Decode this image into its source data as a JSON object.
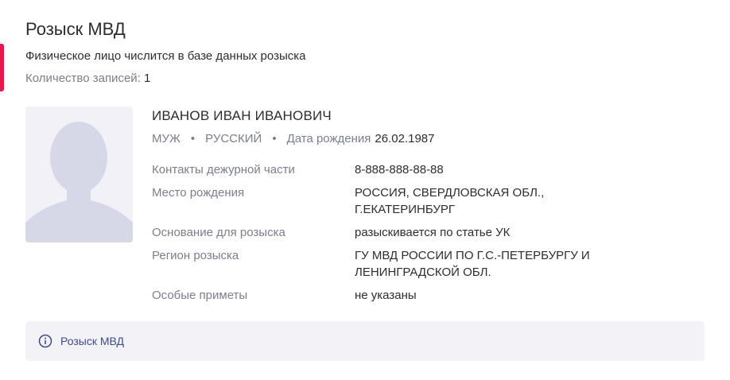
{
  "section": {
    "title": "Розыск МВД",
    "subtitle": "Физическое лицо числится в базе данных розыска",
    "count_label": "Количество записей:",
    "count_value": "1",
    "accent_color": "#e8174b"
  },
  "record": {
    "photo_icon": "person-silhouette-icon",
    "name": "ИВАНОВ ИВАН ИВАНОВИЧ",
    "gender": "МУЖ",
    "nationality": "РУССКИЙ",
    "dob_label": "Дата рождения",
    "dob_value": "26.02.1987",
    "details": [
      {
        "label": "Контакты дежурной части",
        "value": "8-888-888-88-88"
      },
      {
        "label": "Место рождения",
        "value": "РОССИЯ, СВЕРДЛОВСКАЯ ОБЛ., Г.ЕКАТЕРИНБУРГ"
      },
      {
        "label": "Основание для розыска",
        "value": "разыскивается по статье УК"
      },
      {
        "label": "Регион розыска",
        "value": "ГУ МВД РОССИИ ПО Г.С.-ПЕТЕРБУРГУ И ЛЕНИНГРАДСКОЙ ОБЛ."
      },
      {
        "label": "Особые приметы",
        "value": "не указаны"
      }
    ]
  },
  "footer": {
    "icon": "info-icon",
    "link_label": "Розыск МВД"
  }
}
